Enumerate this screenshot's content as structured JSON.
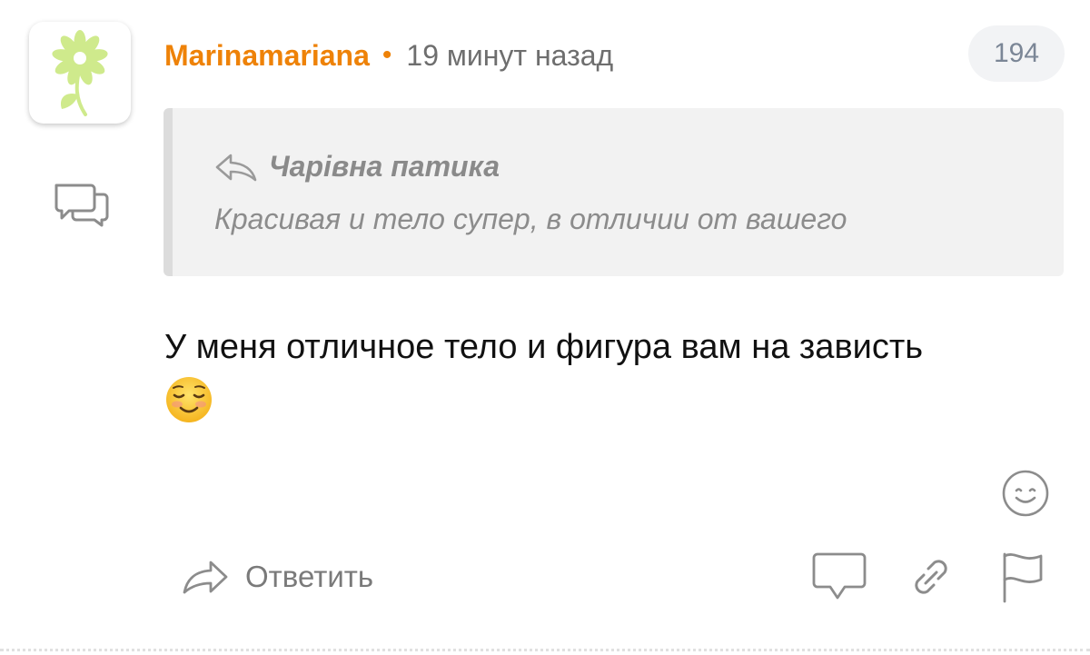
{
  "comment": {
    "author": "Marinamariana",
    "separator": "•",
    "time_ago": "19 минут назад",
    "count": "194",
    "quote": {
      "author": "Чарівна патика",
      "text": "Красивая и тело супер, в отличии от вашего"
    },
    "message": "У меня отличное тело и фигура вам на зависть"
  },
  "actions": {
    "reply_label": "Ответить"
  },
  "icons": {
    "avatar": "flower-icon",
    "side": "comments-icon",
    "quote": "reply-back-icon",
    "message_emoji": "smiling-face-emoji",
    "emoji_picker": "smiley-icon",
    "reply": "reply-arrow-icon",
    "comment": "comment-icon",
    "link": "link-icon",
    "report": "flag-icon"
  },
  "colors": {
    "author": "#ee8208",
    "badge_bg": "#f2f3f5",
    "quote_bg": "#f2f2f2",
    "icon_gray": "#8c8c8c"
  }
}
